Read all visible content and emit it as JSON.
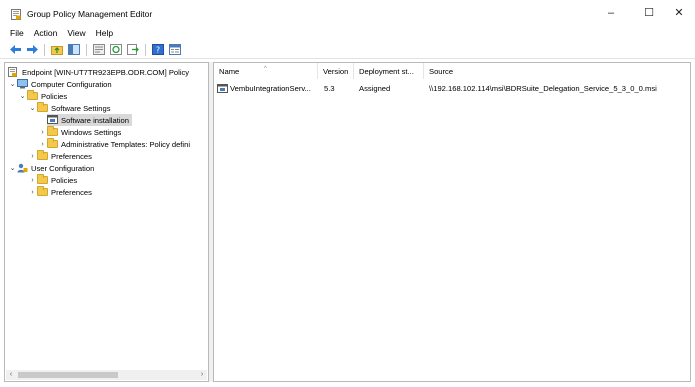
{
  "window": {
    "title": "Group Policy Management Editor",
    "min": "–",
    "max": "☐",
    "close": "✕"
  },
  "menu": [
    "File",
    "Action",
    "View",
    "Help"
  ],
  "toolbar": [
    "back-icon",
    "forward-icon",
    "up-folder-icon",
    "show-tree-icon",
    "properties-icon",
    "refresh-icon",
    "export-icon",
    "help-icon",
    "view-icon"
  ],
  "tree": {
    "root": "Endpoint [WIN-UT7TR923EPB.ODR.COM] Policy",
    "computer": "Computer Configuration",
    "policies": "Policies",
    "software_settings": "Software Settings",
    "software_installation": "Software installation",
    "windows_settings": "Windows Settings",
    "admin_templates": "Administrative Templates: Policy defini",
    "preferences": "Preferences",
    "user": "User Configuration",
    "user_policies": "Policies",
    "user_preferences": "Preferences"
  },
  "list": {
    "headers": {
      "name": "Name",
      "version": "Version",
      "deployment": "Deployment st...",
      "source": "Source"
    },
    "rows": [
      {
        "name": "VembuIntegrationServ...",
        "version": "5.3",
        "deployment": "Assigned",
        "source": "\\\\192.168.102.114\\msi\\BDRSuite_Delegation_Service_5_3_0_0.msi"
      }
    ]
  }
}
